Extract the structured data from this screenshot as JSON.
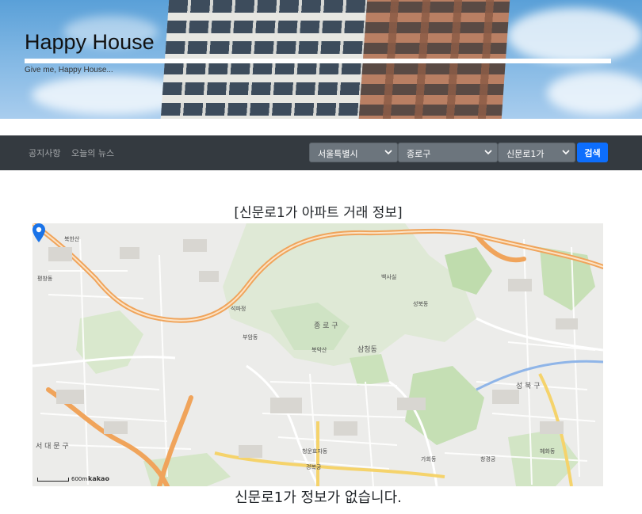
{
  "header": {
    "title": "Happy House",
    "subtitle": "Give me, Happy House..."
  },
  "nav": {
    "links": [
      "공지사항",
      "오늘의 뉴스"
    ],
    "selects": {
      "city": "서울특별시",
      "district": "종로구",
      "dong": "신문로1가"
    },
    "search_label": "검색",
    "chevron_icon": "chevron-down-icon"
  },
  "main": {
    "title": "[신문로1가 아파트 거래 정보]",
    "map": {
      "marker_icon": "map-pin-icon",
      "scale_label": "600m",
      "provider": "kakao",
      "labels": [
        "북한산",
        "종로구",
        "평창동",
        "성북구",
        "서대문구",
        "부암동",
        "청운효자동",
        "경복궁",
        "삼청동",
        "가회동",
        "창경궁",
        "혜화동",
        "성북동",
        "석파정",
        "북악산",
        "백사실"
      ]
    },
    "empty_message": "신문로1가 정보가 없습니다."
  },
  "colors": {
    "navbar": "#343a40",
    "select": "#6c757d",
    "primary": "#0d6efd",
    "marker": "#1a73e8"
  }
}
